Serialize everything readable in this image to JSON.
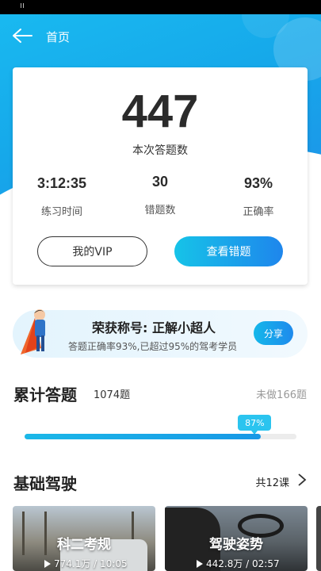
{
  "topbar": {
    "back_label": "首页"
  },
  "summary": {
    "answered_count": "447",
    "answered_label": "本次答题数",
    "stats": [
      {
        "value": "3:12:35",
        "label": "练习时间"
      },
      {
        "value": "30",
        "label": "错题数"
      },
      {
        "value": "93%",
        "label": "正确率"
      }
    ],
    "vip_button": "我的VIP",
    "view_mistakes_button": "查看错题"
  },
  "honor": {
    "title": "荣获称号: 正解小超人",
    "description": "答题正确率93%,已超过95%的驾考学员",
    "share_button": "分享"
  },
  "total": {
    "title": "累计答题",
    "count": "1074题",
    "undone": "未做166题",
    "progress_label": "87%",
    "progress_percent": 87
  },
  "basic": {
    "title": "基础驾驶",
    "lesson_count": "共12课",
    "courses": [
      {
        "name": "科二考规",
        "meta": "774.1万 / 10:05"
      },
      {
        "name": "驾驶姿势",
        "meta": "442.8万 / 02:57"
      }
    ]
  },
  "colors": {
    "accent": "#1aa9ea",
    "progress": "#1bb8e8"
  }
}
